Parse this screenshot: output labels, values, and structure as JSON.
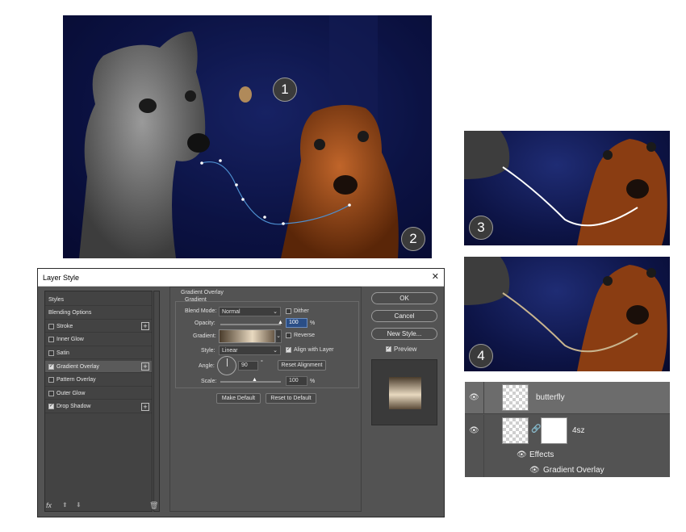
{
  "badges": {
    "b1": "1",
    "b2": "2",
    "b3": "3",
    "b4": "4"
  },
  "dialog": {
    "title": "Layer Style",
    "styles": [
      {
        "label": "Styles",
        "checkbox": false,
        "checked": false,
        "plus": false
      },
      {
        "label": "Blending Options",
        "checkbox": false,
        "checked": false,
        "plus": false
      },
      {
        "label": "Stroke",
        "checkbox": true,
        "checked": false,
        "plus": true
      },
      {
        "label": "Inner Glow",
        "checkbox": true,
        "checked": false,
        "plus": false
      },
      {
        "label": "Satin",
        "checkbox": true,
        "checked": false,
        "plus": false
      },
      {
        "label": "Gradient Overlay",
        "checkbox": true,
        "checked": true,
        "plus": true
      },
      {
        "label": "Pattern Overlay",
        "checkbox": true,
        "checked": false,
        "plus": false
      },
      {
        "label": "Outer Glow",
        "checkbox": true,
        "checked": false,
        "plus": false
      },
      {
        "label": "Drop Shadow",
        "checkbox": true,
        "checked": true,
        "plus": true
      }
    ],
    "footer_fx": "fx",
    "section_title": "Gradient Overlay",
    "group_title": "Gradient",
    "blend_mode_label": "Blend Mode:",
    "blend_mode_value": "Normal",
    "dither_label": "Dither",
    "opacity_label": "Opacity:",
    "opacity_value": "100",
    "opacity_unit": "%",
    "opacity_level": 1.0,
    "gradient_label": "Gradient:",
    "reverse_label": "Reverse",
    "style_label": "Style:",
    "style_value": "Linear",
    "align_label": "Align with Layer",
    "angle_label": "Angle:",
    "angle_value": "90",
    "angle_unit": "°",
    "reset_alignment": "Reset Alignment",
    "scale_label": "Scale:",
    "scale_value": "100",
    "scale_unit": "%",
    "make_default": "Make Default",
    "reset_default": "Reset to Default",
    "ok": "OK",
    "cancel": "Cancel",
    "new_style": "New Style...",
    "preview": "Preview"
  },
  "layers": {
    "butterfly": "butterfly",
    "layer2": "4sz",
    "effects": "Effects",
    "gradient_overlay": "Gradient Overlay"
  },
  "colors": {
    "gold_light": "#e8d9c0",
    "gold_dark": "#4a3c2c",
    "curve_blue": "#4d8fd0"
  }
}
